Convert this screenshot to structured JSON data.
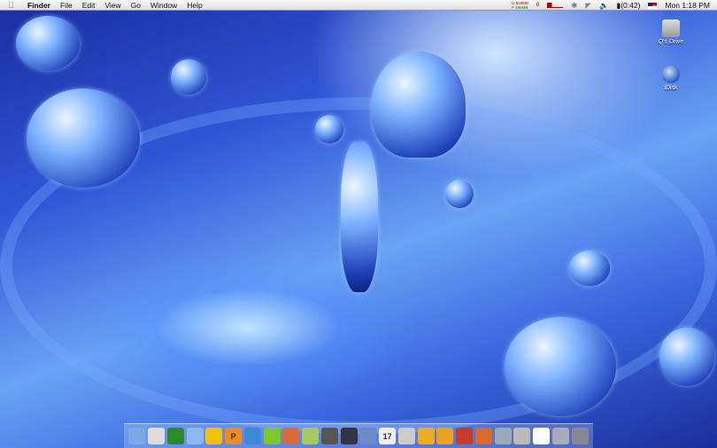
{
  "menubar": {
    "app": "Finder",
    "items": [
      "File",
      "Edit",
      "View",
      "Go",
      "Window",
      "Help"
    ],
    "extras": {
      "memory_used": "U 528MB",
      "memory_free": "F 496MB",
      "counter": "0",
      "battery": "(0:42)",
      "clock": "Mon 1:18 PM"
    }
  },
  "desktop": {
    "icons": [
      {
        "label": "Q's Drive",
        "icon": "hard-drive-icon"
      },
      {
        "label": "iDisk",
        "icon": "idisk-icon"
      }
    ]
  },
  "dock": {
    "items": [
      {
        "name": "finder",
        "color": "#7aa8e8",
        "glyph": ""
      },
      {
        "name": "adium",
        "color": "#ddd",
        "glyph": ""
      },
      {
        "name": "app-green",
        "color": "#2a8a2a",
        "glyph": ""
      },
      {
        "name": "ichat",
        "color": "#8cb8ee",
        "glyph": ""
      },
      {
        "name": "aim",
        "color": "#f2c200",
        "glyph": ""
      },
      {
        "name": "pages",
        "color": "#f08a20",
        "glyph": "P"
      },
      {
        "name": "app-blue",
        "color": "#3a8ad8",
        "glyph": ""
      },
      {
        "name": "app-lime",
        "color": "#7ac82a",
        "glyph": ""
      },
      {
        "name": "app-orange",
        "color": "#d86a3a",
        "glyph": ""
      },
      {
        "name": "app-photo",
        "color": "#a6c860",
        "glyph": ""
      },
      {
        "name": "imovie",
        "color": "#555",
        "glyph": ""
      },
      {
        "name": "final-cut",
        "color": "#334",
        "glyph": ""
      },
      {
        "name": "preview",
        "color": "#6a8ac8",
        "glyph": ""
      },
      {
        "name": "ical",
        "color": "#eee",
        "glyph": "17"
      },
      {
        "name": "apple-app",
        "color": "#ccc",
        "glyph": ""
      },
      {
        "name": "app-yellow",
        "color": "#e8b020",
        "glyph": ""
      },
      {
        "name": "app-smiley",
        "color": "#f0a020",
        "glyph": ""
      },
      {
        "name": "app-red",
        "color": "#c83a2a",
        "glyph": ""
      },
      {
        "name": "firefox",
        "color": "#d86a2a",
        "glyph": ""
      },
      {
        "name": "itunes",
        "color": "#9ab",
        "glyph": ""
      },
      {
        "name": "app-printer",
        "color": "#bbb",
        "glyph": ""
      },
      {
        "name": "app-cow",
        "color": "#fff",
        "glyph": ""
      },
      {
        "name": "folder",
        "color": "#aab",
        "glyph": ""
      },
      {
        "name": "trash",
        "color": "#889",
        "glyph": ""
      }
    ]
  }
}
